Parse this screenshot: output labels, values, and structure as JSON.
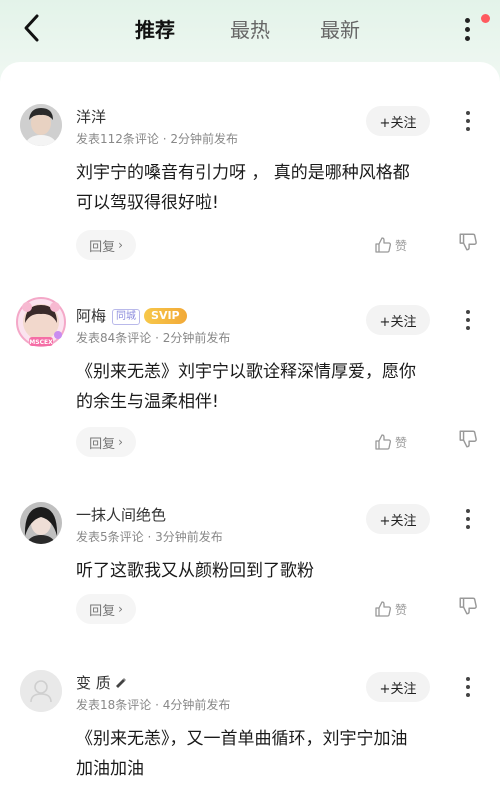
{
  "header": {
    "tabs": [
      "推荐",
      "最热",
      "最新"
    ],
    "active_tab": "推荐",
    "notification_dot": true
  },
  "common": {
    "follow_label": "+关注",
    "reply_label": "回复",
    "like_label": "赞"
  },
  "comments": [
    {
      "username": "洋洋",
      "meta": "发表112条评论 · 2分钟前发布",
      "lines": [
        "刘宇宁的嗓音有引力呀 ， 真的是哪种风格都",
        "可以驾驭得很好啦!"
      ]
    },
    {
      "username": "阿梅",
      "badges": [
        "同城",
        "SVIP"
      ],
      "avatar_frame_text": "MSCEX",
      "meta": "发表84条评论 · 2分钟前发布",
      "lines": [
        "《别来无恙》刘宇宁以歌诠释深情厚爱，愿你",
        "的余生与温柔相伴!"
      ]
    },
    {
      "username": "一抹人间绝色",
      "meta": "发表5条评论 · 3分钟前发布",
      "lines": [
        "听了这歌我又从颜粉回到了歌粉"
      ]
    },
    {
      "username": "变 质",
      "meta": "发表18条评论 · 4分钟前发布",
      "lines": [
        "《别来无恙》，又一首单曲循环，刘宇宁加油",
        "加油加油"
      ]
    }
  ],
  "colors": {
    "header_bg": "#e3f3e9",
    "notification_dot": "#ff5a5f",
    "svip_badge": "#f2a938",
    "tongcheng_badge": "#8c8cdd"
  }
}
